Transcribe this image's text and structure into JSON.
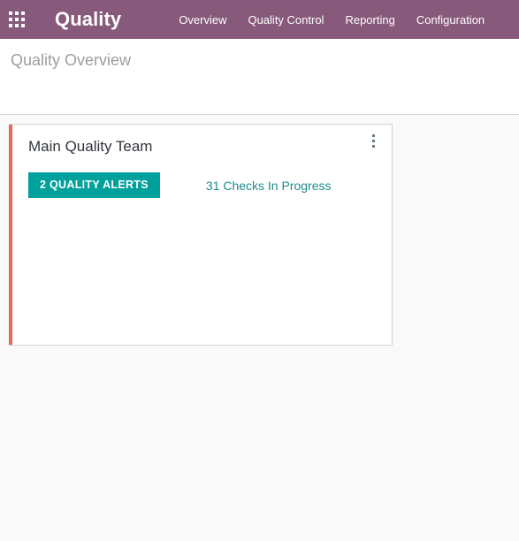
{
  "navbar": {
    "apps_icon": "apps-grid-icon",
    "brand": "Quality",
    "background_color": "#875A7B",
    "menu": [
      {
        "label": "Overview"
      },
      {
        "label": "Quality Control"
      },
      {
        "label": "Reporting"
      },
      {
        "label": "Configuration"
      }
    ]
  },
  "control_panel": {
    "breadcrumb": "Quality Overview"
  },
  "content": {
    "cards": [
      {
        "title": "Main Quality Team",
        "stripe_color": "#E6685C",
        "menu_icon": "vertical-ellipsis-icon",
        "alerts_badge": {
          "label": "2 QUALITY ALERTS",
          "count": 2,
          "color": "#00A09D"
        },
        "checks_link": {
          "label": "31 Checks In Progress",
          "count": 31,
          "color": "#1F8A8C"
        }
      }
    ]
  }
}
